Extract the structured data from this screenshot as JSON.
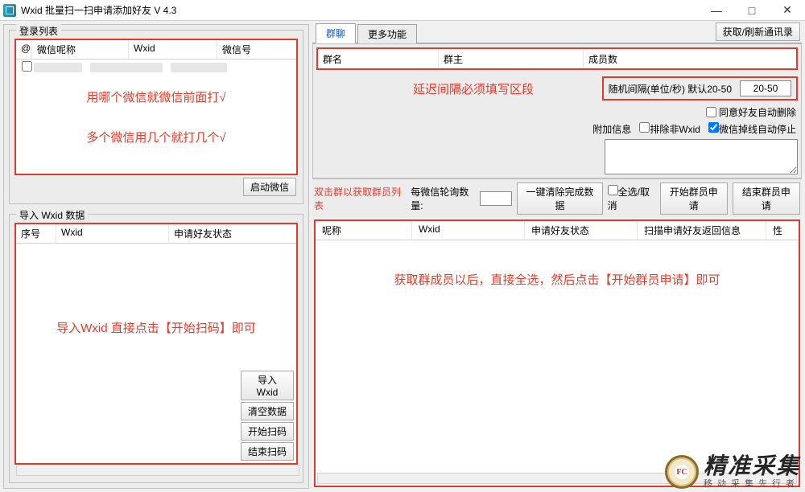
{
  "title": "Wxid 批量扫一扫申请添加好友 V 4.3",
  "login": {
    "legend": "登录列表",
    "headers": {
      "c0": "@",
      "c1": "微信呢称",
      "c2": "Wxid",
      "c3": "微信号"
    },
    "note1": "用哪个微信就微信前面打√",
    "note2": "多个微信用几个就打几个√",
    "start_btn": "启动微信"
  },
  "import": {
    "legend": "导入 Wxid 数据",
    "headers": {
      "c0": "序号",
      "c1": "Wxid",
      "c2": "申请好友状态"
    },
    "note": "导入Wxid 直接点击【开始扫码】即可",
    "btns": {
      "import": "导入Wxid",
      "clear": "清空数据",
      "start": "开始扫码",
      "end": "结束扫码"
    }
  },
  "tabs": {
    "group": "群聊",
    "more": "更多功能",
    "refresh": "获取/刷新通讯录"
  },
  "group_list_headers": {
    "c0": "群名",
    "c1": "群主",
    "c2": "成员数"
  },
  "delay": {
    "note": "延迟间隔必须填写区段",
    "label": "随机间隔(单位/秒) 默认20-50",
    "value": "20-50"
  },
  "opts": {
    "auto_del": "同意好友自动删除",
    "attach_label": "附加信息",
    "exclude": "排除非Wxid",
    "offline_stop": "微信掉线自动停止"
  },
  "toolbar": {
    "dbl_hint": "双击群以获取群员列表",
    "poll_label": "每微信轮询数量:",
    "one_clear": "一键清除完成数据",
    "select_all": "全选/取消",
    "start_apply": "开始群员申请",
    "end_apply": "结束群员申请"
  },
  "members": {
    "headers": {
      "c0": "呢称",
      "c1": "Wxid",
      "c2": "申请好友状态",
      "c3": "扫描申请好友返回信息",
      "c4": "性"
    },
    "note": "获取群成员以后，直接全选，然后点击【开始群员申请】即可"
  },
  "watermark": {
    "seal": "FC",
    "big": "精准采集",
    "small": "移动采集先行者"
  }
}
